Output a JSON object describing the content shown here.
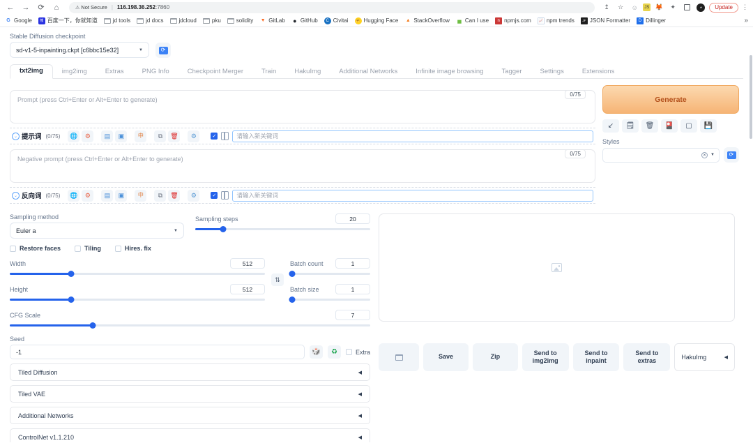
{
  "browser": {
    "nav": {
      "back": "←",
      "forward": "→",
      "reload": "C",
      "home": "⌂"
    },
    "security_label": "Not Secure",
    "url_host": "116.198.36.252",
    "url_port": ":7860",
    "update_label": "Update",
    "bookmarks": [
      {
        "label": "Google",
        "icon": "google-icon",
        "glyph": "G",
        "color": "#4285f4",
        "type": "glyph"
      },
      {
        "label": "百度一下，你就知道",
        "icon": "baidu-icon",
        "glyph": "熊",
        "color": "#2932e1",
        "type": "glyph"
      },
      {
        "label": "jd tools",
        "icon": "folder-icon",
        "type": "folder"
      },
      {
        "label": "jd docs",
        "icon": "folder-icon",
        "type": "folder"
      },
      {
        "label": "jdcloud",
        "icon": "folder-icon",
        "type": "folder"
      },
      {
        "label": "pku",
        "icon": "folder-icon",
        "type": "folder"
      },
      {
        "label": "solidity",
        "icon": "folder-icon",
        "type": "folder"
      },
      {
        "label": "GitLab",
        "icon": "gitlab-icon",
        "glyph": "🦊",
        "color": "#fc6d26",
        "type": "glyph"
      },
      {
        "label": "GitHub",
        "icon": "github-icon",
        "glyph": "⬤",
        "color": "#24292e",
        "type": "glyph"
      },
      {
        "label": "Civitai",
        "icon": "civitai-icon",
        "glyph": "C",
        "color": "#1971c2",
        "type": "glyph"
      },
      {
        "label": "Hugging Face",
        "icon": "huggingface-icon",
        "glyph": "🤗",
        "color": "#ffd21e",
        "type": "glyph"
      },
      {
        "label": "StackOverflow",
        "icon": "stackoverflow-icon",
        "glyph": "▲",
        "color": "#f48024",
        "type": "glyph"
      },
      {
        "label": "Can I use",
        "icon": "caniuse-icon",
        "glyph": "▅",
        "color": "#6fbe44",
        "type": "glyph"
      },
      {
        "label": "npmjs.com",
        "icon": "npm-icon",
        "glyph": "n",
        "color": "#cb3837",
        "type": "glyph"
      },
      {
        "label": "npm trends",
        "icon": "npmtrends-icon",
        "glyph": "📈",
        "color": "#7aa7d9",
        "type": "glyph"
      },
      {
        "label": "JSON Formatter",
        "icon": "jsonformatter-icon",
        "glyph": "JF",
        "color": "#1f1f1f",
        "type": "glyph"
      },
      {
        "label": "Dillinger",
        "icon": "dillinger-icon",
        "glyph": "D",
        "color": "#1f6feb",
        "type": "glyph"
      }
    ],
    "bookmarks_overflow": "»",
    "toolbar_icons": [
      {
        "name": "share-icon",
        "glyph": "↥"
      },
      {
        "name": "bookmark-star-icon",
        "glyph": "☆"
      },
      {
        "name": "profile-smile-icon",
        "glyph": "☺"
      },
      {
        "name": "extension-js-icon",
        "glyph": "JS"
      },
      {
        "name": "extension-fox-icon",
        "glyph": "🦊"
      },
      {
        "name": "extensions-puzzle-icon",
        "glyph": "🧩"
      },
      {
        "name": "side-panel-icon",
        "glyph": "▣"
      }
    ]
  },
  "checkpoint": {
    "label": "Stable Diffusion checkpoint",
    "value": "sd-v1-5-inpainting.ckpt [c6bbc15e32]",
    "caret": "▼",
    "refresh_icon": "refresh-icon",
    "refresh_glyph": "⟳"
  },
  "tabs": [
    {
      "label": "txt2img",
      "active": true
    },
    {
      "label": "img2img",
      "active": false
    },
    {
      "label": "Extras",
      "active": false
    },
    {
      "label": "PNG Info",
      "active": false
    },
    {
      "label": "Checkpoint Merger",
      "active": false
    },
    {
      "label": "Train",
      "active": false
    },
    {
      "label": "HakuImg",
      "active": false
    },
    {
      "label": "Additional Networks",
      "active": false
    },
    {
      "label": "Infinite image browsing",
      "active": false
    },
    {
      "label": "Tagger",
      "active": false
    },
    {
      "label": "Settings",
      "active": false
    },
    {
      "label": "Extensions",
      "active": false
    }
  ],
  "prompt": {
    "token_count": "0/75",
    "placeholder": "Prompt (press Ctrl+Enter or Alt+Enter to generate)",
    "value": ""
  },
  "negative_prompt": {
    "token_count": "0/75",
    "placeholder": "Negative prompt (press Ctrl+Enter or Alt+Enter to generate)",
    "value": ""
  },
  "keyword_bar_positive": {
    "chevron": "⌄",
    "title": "提示词",
    "count": "(0/75)",
    "input_placeholder": "请输入新关键词",
    "tools": [
      {
        "name": "globe-translate-icon",
        "glyph": "🌐",
        "color": "#e8654a"
      },
      {
        "name": "settings-gear-icon",
        "glyph": "⚙",
        "color": "#e8654a"
      },
      {
        "name": "paste-text-icon",
        "glyph": "▤",
        "color": "#4a90d9"
      },
      {
        "name": "save-tag-icon",
        "glyph": "▣",
        "color": "#4a90d9"
      },
      {
        "name": "chinese-translate-icon",
        "glyph": "中",
        "color": "#e07b39"
      },
      {
        "name": "copy-icon",
        "glyph": "⧉",
        "color": "#6b7280"
      },
      {
        "name": "delete-trash-icon",
        "glyph": "🗑",
        "color": "#dc2626"
      },
      {
        "name": "blue-gear-icon",
        "glyph": "⚙",
        "color": "#5b9bd5"
      }
    ],
    "checkbox_checked": true,
    "split_icon": "split-panel-icon"
  },
  "keyword_bar_negative": {
    "chevron": "⌄",
    "title": "反向词",
    "count": "(0/75)",
    "input_placeholder": "请输入新关键词",
    "tools": [
      {
        "name": "globe-translate-icon",
        "glyph": "🌐",
        "color": "#e8654a"
      },
      {
        "name": "settings-gear-icon",
        "glyph": "⚙",
        "color": "#e8654a"
      },
      {
        "name": "paste-text-icon",
        "glyph": "▤",
        "color": "#4a90d9"
      },
      {
        "name": "save-tag-icon",
        "glyph": "▣",
        "color": "#4a90d9"
      },
      {
        "name": "chinese-translate-icon",
        "glyph": "中",
        "color": "#e07b39"
      },
      {
        "name": "copy-icon",
        "glyph": "⧉",
        "color": "#6b7280"
      },
      {
        "name": "delete-trash-icon",
        "glyph": "🗑",
        "color": "#dc2626"
      },
      {
        "name": "blue-gear-icon",
        "glyph": "⚙",
        "color": "#5b9bd5"
      }
    ],
    "checkbox_checked": true,
    "split_icon": "split-panel-icon"
  },
  "generate": {
    "label": "Generate",
    "tools": [
      {
        "name": "restore-progress-icon",
        "glyph": "↙"
      },
      {
        "name": "paste-prompt-icon",
        "glyph": "📝"
      },
      {
        "name": "clear-prompt-icon",
        "glyph": "🗑"
      },
      {
        "name": "extra-networks-icon",
        "glyph": "🎴"
      },
      {
        "name": "apply-style-icon",
        "glyph": "📋"
      },
      {
        "name": "save-style-icon",
        "glyph": "💾"
      }
    ]
  },
  "styles": {
    "label": "Styles",
    "value": "",
    "clear_icon": "clear-x-icon",
    "caret": "▼",
    "refresh_icon": "refresh-styles-icon",
    "refresh_glyph": "⟳"
  },
  "sampling": {
    "method_label": "Sampling method",
    "method_value": "Euler a",
    "steps_label": "Sampling steps",
    "steps_value": "20",
    "steps_pct": 16
  },
  "toggles": [
    {
      "label": "Restore faces",
      "checked": false
    },
    {
      "label": "Tiling",
      "checked": false
    },
    {
      "label": "Hires. fix",
      "checked": false
    }
  ],
  "dimensions": {
    "width_label": "Width",
    "width_value": "512",
    "width_pct": 24,
    "height_label": "Height",
    "height_value": "512",
    "height_pct": 24,
    "swap_icon": "swap-dimensions-icon",
    "swap_glyph": "⇅"
  },
  "batch": {
    "count_label": "Batch count",
    "count_value": "1",
    "count_pct": 2,
    "size_label": "Batch size",
    "size_value": "1",
    "size_pct": 2
  },
  "cfg": {
    "label": "CFG Scale",
    "value": "7",
    "pct": 23
  },
  "seed": {
    "label": "Seed",
    "value": "-1",
    "random_icon": "random-dice-icon",
    "random_glyph": "🎲",
    "recycle_icon": "recycle-seed-icon",
    "recycle_glyph": "♻",
    "extra_label": "Extra",
    "extra_checked": false
  },
  "accordions": [
    {
      "label": "Tiled Diffusion",
      "arrow": "◀"
    },
    {
      "label": "Tiled VAE",
      "arrow": "◀"
    },
    {
      "label": "Additional Networks",
      "arrow": "◀"
    },
    {
      "label": "ControlNet v1.1.210",
      "arrow": "◀"
    }
  ],
  "output": {
    "placeholder_icon": "image-placeholder-icon",
    "actions": [
      {
        "name": "open-folder-button",
        "label": "",
        "icon": "folder-icon",
        "kind": "folder"
      },
      {
        "name": "save-button",
        "label": "Save",
        "kind": "wide"
      },
      {
        "name": "zip-button",
        "label": "Zip",
        "kind": "wide"
      },
      {
        "name": "send-to-img2img-button",
        "label": "Send to\nimg2img",
        "kind": "send"
      },
      {
        "name": "send-to-inpaint-button",
        "label": "Send to\ninpaint",
        "kind": "send"
      },
      {
        "name": "send-to-extras-button",
        "label": "Send to\nextras",
        "kind": "send"
      }
    ],
    "dropdown_label": "HakuImg",
    "dropdown_arrow": "◀"
  }
}
